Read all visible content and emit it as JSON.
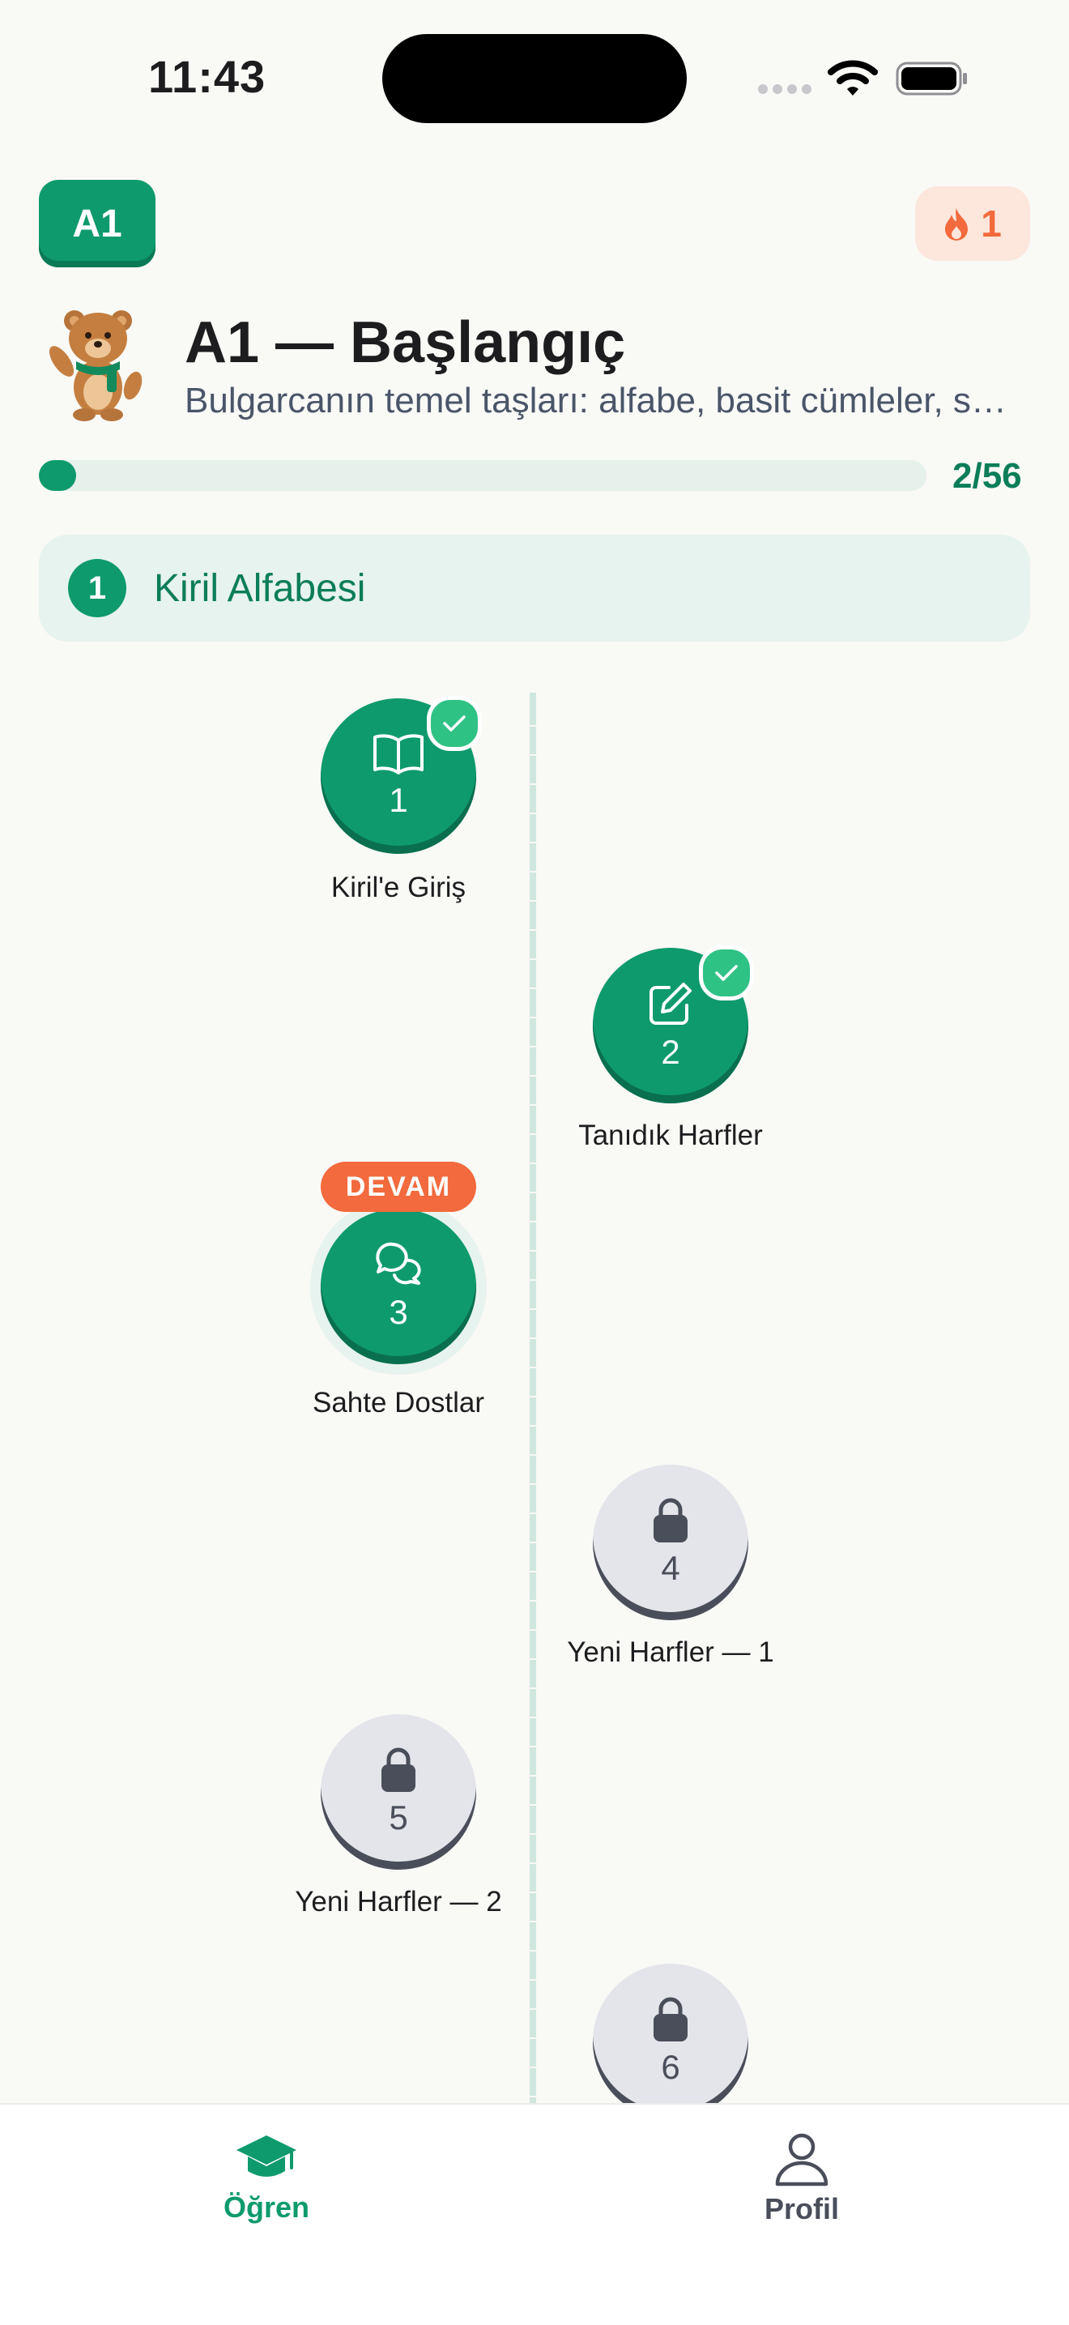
{
  "status_bar": {
    "time": "11:43"
  },
  "header": {
    "level_badge": "A1",
    "streak_count": "1",
    "level_title": "A1 — Başlangıç",
    "level_subtitle": "Bulgarcanın temel taşları: alfabe, basit cümleler, selamlaşma",
    "progress_text": "2/56",
    "progress_fraction": 0.036
  },
  "unit": {
    "number": "1",
    "title": "Kiril Alfabesi"
  },
  "lessons": [
    {
      "number": "1",
      "title": "Kiril'e Giriş",
      "state": "completed",
      "icon": "book-icon"
    },
    {
      "number": "2",
      "title": "Tanıdık Harfler",
      "state": "completed",
      "icon": "edit-icon"
    },
    {
      "number": "3",
      "title": "Sahte Dostlar",
      "state": "current",
      "icon": "chat-icon",
      "badge": "DEVAM"
    },
    {
      "number": "4",
      "title": "Yeni Harfler — 1",
      "state": "locked",
      "icon": "lock-icon"
    },
    {
      "number": "5",
      "title": "Yeni Harfler — 2",
      "state": "locked",
      "icon": "lock-icon"
    },
    {
      "number": "6",
      "title": "",
      "state": "locked",
      "icon": "lock-icon"
    }
  ],
  "tabs": [
    {
      "label": "Öğren",
      "icon": "graduation-cap-icon",
      "active": true
    },
    {
      "label": "Profil",
      "icon": "person-icon",
      "active": false
    }
  ],
  "colors": {
    "accent": "#0e9a6d",
    "accent_dark": "#0b7d59",
    "streak": "#f26a3d",
    "locked": "#e4e5ea",
    "background": "#f9f9f6"
  }
}
